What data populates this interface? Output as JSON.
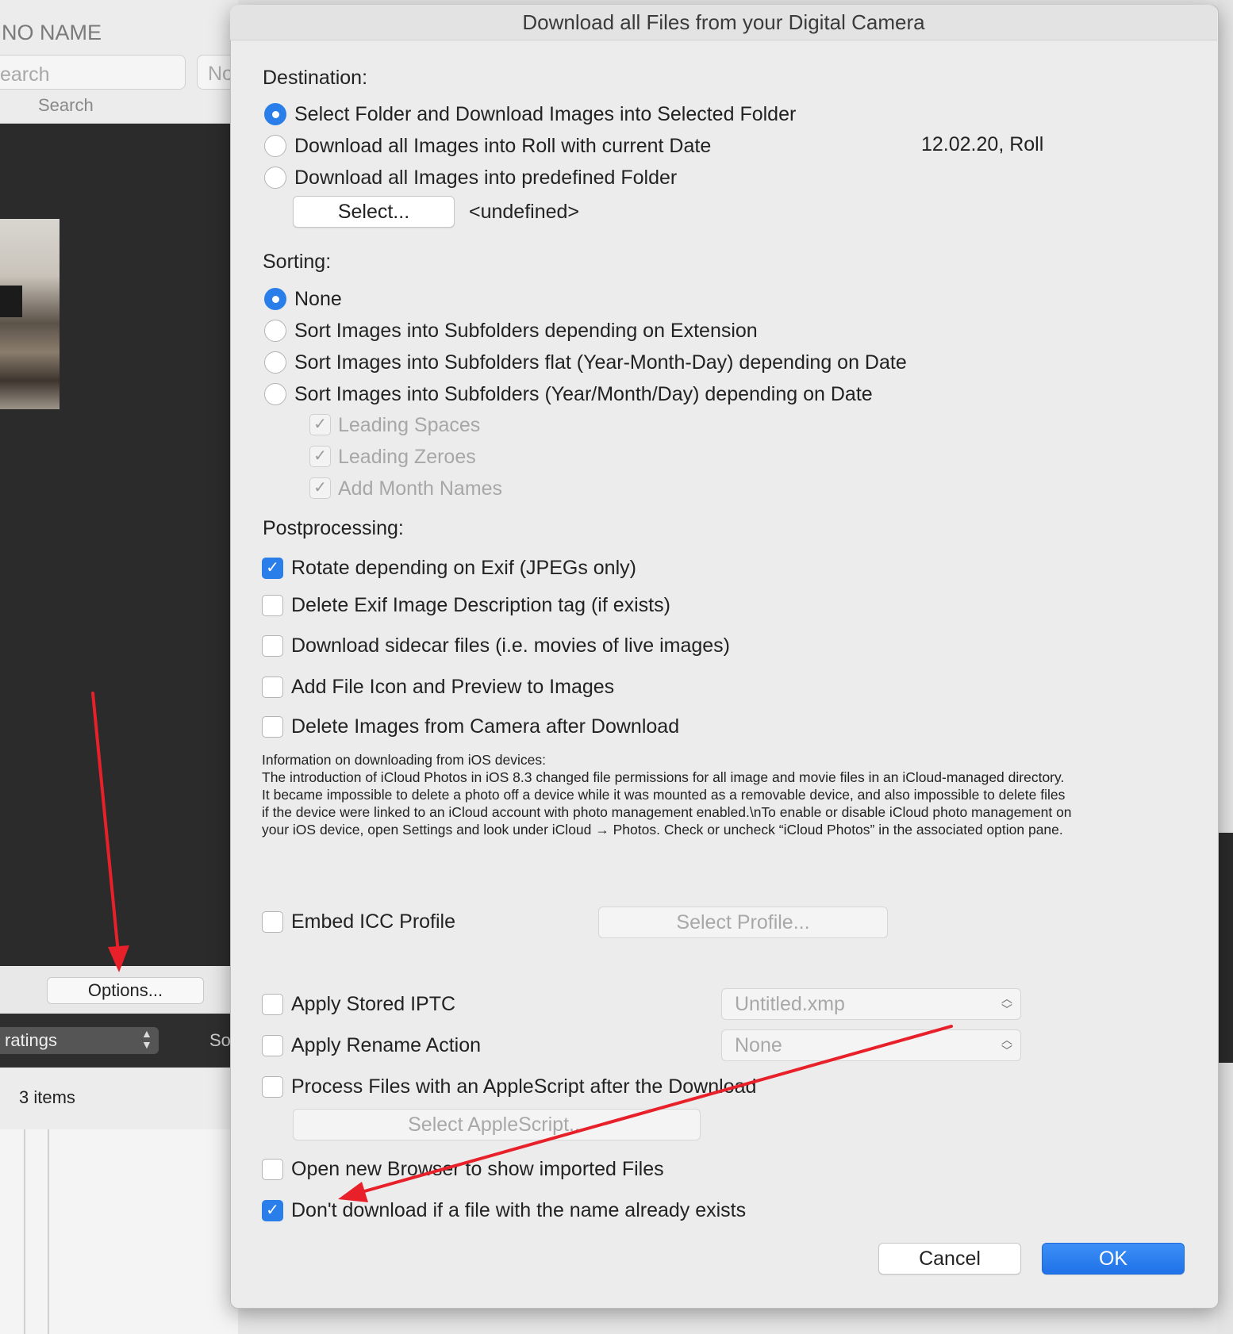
{
  "background_window": {
    "volume_title": "NO NAME",
    "search_placeholder": "earch",
    "search_label": "Search",
    "secondary_field_text": "No",
    "options_button": "Options...",
    "ratings_select": "ratings",
    "sort_label_partial": "So",
    "items_count": "3 items"
  },
  "dialog": {
    "title": "Download all Files from your Digital Camera",
    "destination": {
      "heading": "Destination:",
      "options": [
        {
          "label": "Select Folder and Download Images into Selected Folder",
          "selected": true
        },
        {
          "label": "Download all Images into Roll with current Date",
          "selected": false
        },
        {
          "label": "Download all Images into predefined Folder",
          "selected": false
        }
      ],
      "roll_preview": "12.02.20, Roll",
      "select_button": "Select...",
      "folder_value": "<undefined>"
    },
    "sorting": {
      "heading": "Sorting:",
      "options": [
        {
          "label": "None",
          "selected": true
        },
        {
          "label": "Sort Images into Subfolders depending on Extension",
          "selected": false
        },
        {
          "label": "Sort Images into Subfolders flat (Year-Month-Day) depending on Date",
          "selected": false
        },
        {
          "label": "Sort Images into Subfolders (Year/Month/Day) depending on Date",
          "selected": false
        }
      ],
      "sub_options": [
        {
          "label": "Leading Spaces",
          "checked": true,
          "enabled": false
        },
        {
          "label": "Leading Zeroes",
          "checked": true,
          "enabled": false
        },
        {
          "label": "Add Month Names",
          "checked": true,
          "enabled": false
        }
      ]
    },
    "postprocessing": {
      "heading": "Postprocessing:",
      "options": [
        {
          "label": "Rotate depending on Exif (JPEGs only)",
          "checked": true
        },
        {
          "label": "Delete Exif Image Description tag (if exists)",
          "checked": false
        },
        {
          "label": "Download sidecar files (i.e. movies of live images)",
          "checked": false
        },
        {
          "label": "Add File Icon and Preview to Images",
          "checked": false
        },
        {
          "label": "Delete Images from Camera after Download",
          "checked": false
        }
      ]
    },
    "info_lines": [
      "Information on downloading from iOS devices:",
      "The introduction of iCloud Photos in iOS 8.3 changed file permissions for all image and movie files in an iCloud-managed directory.",
      "It became impossible to delete a photo off a device while it was mounted as a removable device, and also impossible to delete files",
      "if the device were linked to an iCloud account with photo management enabled.\\nTo enable or disable iCloud photo management on",
      "your iOS device, open Settings and look under iCloud → Photos. Check or uncheck “iCloud Photos” in the associated option pane."
    ],
    "embed_icc": {
      "label": "Embed ICC Profile",
      "checked": false,
      "button": "Select Profile..."
    },
    "apply_iptc": {
      "label": "Apply Stored IPTC",
      "checked": false,
      "value": "Untitled.xmp"
    },
    "apply_rename": {
      "label": "Apply Rename Action",
      "checked": false,
      "value": "None"
    },
    "applescript": {
      "label": "Process Files with an AppleScript after the Download",
      "checked": false,
      "button": "Select AppleScript..."
    },
    "open_browser": {
      "label": "Open new Browser to show imported Files",
      "checked": false
    },
    "skip_existing": {
      "label": "Don't download if a file with the name already exists",
      "checked": true
    },
    "cancel_button": "Cancel",
    "ok_button": "OK"
  },
  "colors": {
    "accent": "#2a7ee9",
    "annotation_arrow": "#e8202a"
  },
  "icons": {
    "check": "checkmark-icon",
    "popup": "updown-chevron-icon"
  }
}
